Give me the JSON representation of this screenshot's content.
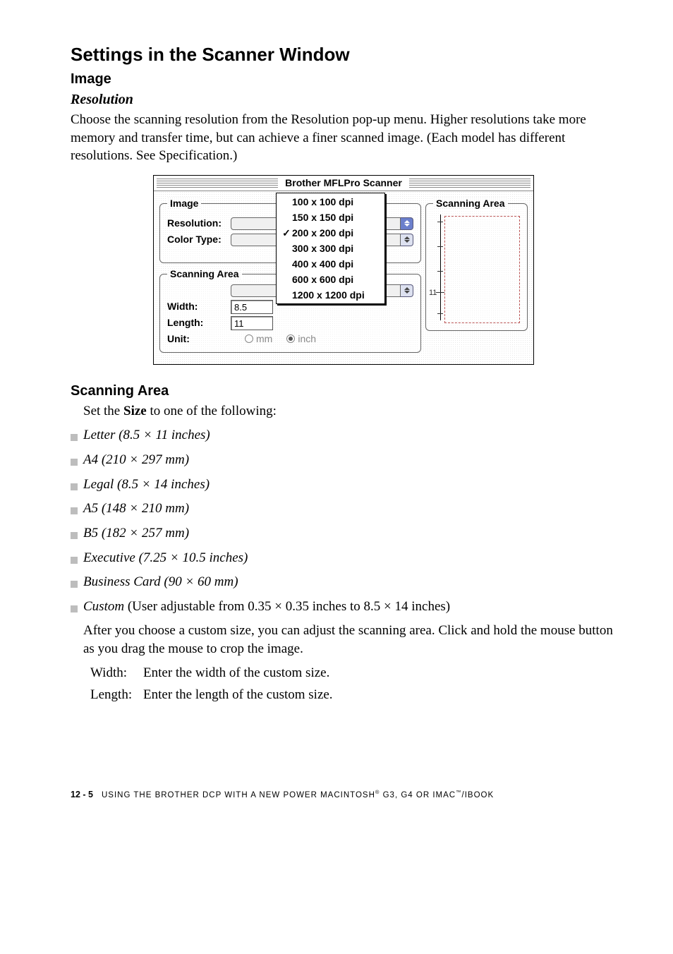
{
  "h1": "Settings in the Scanner Window",
  "h2_image": "Image",
  "h3_resolution": "Resolution",
  "p_resolution": "Choose the scanning resolution from the Resolution pop-up menu. Higher resolutions take more memory and transfer time, but can achieve a finer scanned image. (Each model has different resolutions. See Specification.)",
  "dialog": {
    "title": "Brother MFLPro Scanner",
    "image_legend": "Image",
    "res_label": "Resolution:",
    "color_label": "Color Type:",
    "scanarea_left_legend": "Scanning Area",
    "width_label": "Width:",
    "width_value": "8.5",
    "length_label": "Length:",
    "length_value": "11",
    "unit_label": "Unit:",
    "unit_mm": "mm",
    "unit_inch": "inch",
    "menu": {
      "items": [
        {
          "label": "100 x 100 dpi",
          "checked": false
        },
        {
          "label": "150 x 150 dpi",
          "checked": false
        },
        {
          "label": "200 x 200 dpi",
          "checked": true
        },
        {
          "label": "300 x 300 dpi",
          "checked": false
        },
        {
          "label": "400 x 400 dpi",
          "checked": false
        },
        {
          "label": "600 x 600 dpi",
          "checked": false
        },
        {
          "label": "1200 x 1200 dpi",
          "checked": false
        }
      ]
    },
    "scanarea_legend": "Scanning Area",
    "scan_ruler_label": "11"
  },
  "h2_scanning": "Scanning Area",
  "size_intro_pre": "Set the ",
  "size_intro_bold": "Size",
  "size_intro_post": " to one of the following:",
  "bullets": [
    {
      "text": "Letter (8.5 × 11 inches)",
      "italic_all": true
    },
    {
      "text": "A4 (210 × 297 mm)",
      "italic_all": true
    },
    {
      "text": "Legal (8.5 × 14 inches)",
      "italic_all": true
    },
    {
      "text": "A5 (148 × 210 mm)",
      "italic_all": true
    },
    {
      "text": "B5 (182 × 257 mm)",
      "italic_all": true
    },
    {
      "text": "Executive (7.25 × 10.5 inches)",
      "italic_all": true
    },
    {
      "text": "Business Card (90 × 60 mm)",
      "italic_all": true
    }
  ],
  "custom_lead": "Custom",
  "custom_tail": " (User adjustable from 0.35 × 0.35 inches to 8.5 × 14 inches)",
  "custom_para": "After you choose a custom size, you can adjust the scanning area. Click and hold the mouse button as you drag the mouse to crop the image.",
  "defs": {
    "width_key": "Width:",
    "width_val": "Enter the width of the custom size.",
    "length_key": "Length:",
    "length_val": "Enter the length of the custom size."
  },
  "footer": {
    "pg": "12 - 5",
    "part1": "USING THE BROTHER DCP WITH A NEW POWER MACINTOSH",
    "reg": "®",
    "part2": " G3, G4 OR IMAC",
    "tm": "™",
    "part3": "/IBOOK"
  }
}
